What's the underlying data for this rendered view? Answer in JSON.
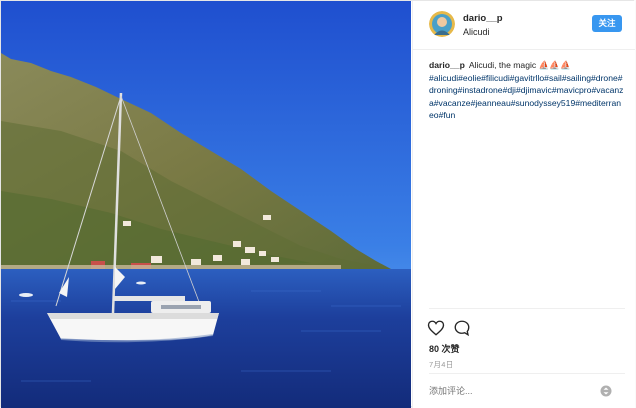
{
  "post": {
    "username": "dario__p",
    "location": "Alicudi",
    "follow_label": "关注",
    "caption_text": "Alicudi, the magic ⛵⛵⛵",
    "hashtags": [
      "#alicudi",
      "#eolie",
      "#filicudi",
      "#gavitrllo",
      "#sail",
      "#sailing",
      "#drone",
      "#droning",
      "#instadrone",
      "#dji",
      "#djimavic",
      "#mavicpro",
      "#vacanza",
      "#vacanze",
      "#jeanneau",
      "#sunodyssey519",
      "#mediterraneo",
      "#fun"
    ],
    "likes": "80 次赞",
    "date": "7月4日",
    "comment_placeholder": "添加评论..."
  },
  "icons": {
    "like": "heart-outline-icon",
    "comment": "speech-bubble-icon",
    "more": "more-options-icon",
    "avatar": "user-avatar"
  },
  "colors": {
    "follow_button": "#3897f0",
    "hashtag": "#003569",
    "sea": "#1c3f9e",
    "sky": "#2a5fd8"
  }
}
